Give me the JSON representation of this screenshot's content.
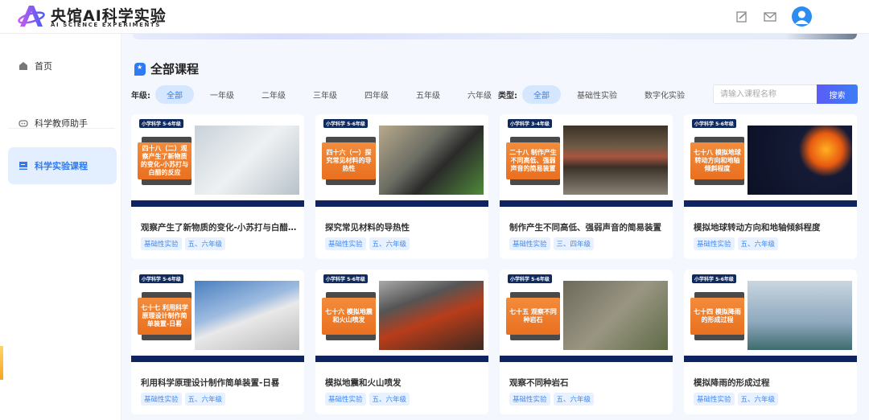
{
  "header": {
    "brand": "央馆AI科学实验",
    "brand_sub": "AI SCIENCE EXPERIMENTS",
    "icons": [
      "edit-icon",
      "mail-icon",
      "user-avatar"
    ]
  },
  "sidebar": {
    "items": [
      {
        "label": "首页",
        "icon": "home-icon"
      },
      {
        "label": "科学教师助手",
        "icon": "robot-icon"
      },
      {
        "label": "科学实验课程",
        "icon": "monitor-icon",
        "active": true
      }
    ]
  },
  "main": {
    "title": "全部课程",
    "grade_filter": {
      "label": "年级:",
      "options": [
        "全部",
        "一年级",
        "二年级",
        "三年级",
        "四年级",
        "五年级",
        "六年级"
      ],
      "selected": "全部"
    },
    "type_filter": {
      "label": "类型:",
      "options": [
        "全部",
        "基础性实验",
        "数字化实验"
      ],
      "selected": "全部"
    },
    "search": {
      "placeholder": "请输入课程名称",
      "button": "搜索"
    },
    "courses": [
      {
        "badge": "小学科学 5-6年级",
        "cover": "四十八（二）观察产生了新物质的变化-小苏打与白醋的反应",
        "title": "观察产生了新物质的变化-小苏打与白醋的反应",
        "tags": [
          "基础性实验",
          "五、六年级"
        ]
      },
      {
        "badge": "小学科学 5-6年级",
        "cover": "四十六（一）探究常见材料的导热性",
        "title": "探究常见材料的导热性",
        "tags": [
          "基础性实验",
          "五、六年级"
        ]
      },
      {
        "badge": "小学科学 3-4年级",
        "cover": "二十八 制作产生不同高低、强弱声音的简易装置",
        "title": "制作产生不同高低、强弱声音的简易装置",
        "tags": [
          "基础性实验",
          "三、四年级"
        ]
      },
      {
        "badge": "小学科学 5-6年级",
        "cover": "七十八 模拟地球转动方向和地轴倾斜程度",
        "title": "模拟地球转动方向和地轴倾斜程度",
        "tags": [
          "基础性实验",
          "五、六年级"
        ]
      },
      {
        "badge": "小学科学 5-6年级",
        "cover": "七十七 利用科学原理设计制作简单装置-日晷",
        "title": "利用科学原理设计制作简单装置-日晷",
        "tags": [
          "基础性实验",
          "五、六年级"
        ]
      },
      {
        "badge": "小学科学 5-6年级",
        "cover": "七十六 模拟地震和火山喷发",
        "title": "模拟地震和火山喷发",
        "tags": [
          "基础性实验",
          "五、六年级"
        ]
      },
      {
        "badge": "小学科学 5-6年级",
        "cover": "七十五 观察不同种岩石",
        "title": "观察不同种岩石",
        "tags": [
          "基础性实验",
          "五、六年级"
        ]
      },
      {
        "badge": "小学科学 5-6年级",
        "cover": "七十四 模拟降雨的形成过程",
        "title": "模拟降雨的形成过程",
        "tags": [
          "基础性实验",
          "五、六年级"
        ]
      }
    ]
  },
  "colors": {
    "accent": "#2f7bf5",
    "navy": "#0e2461",
    "orange": "#ec7a2a",
    "bg": "#f4f7fd"
  }
}
